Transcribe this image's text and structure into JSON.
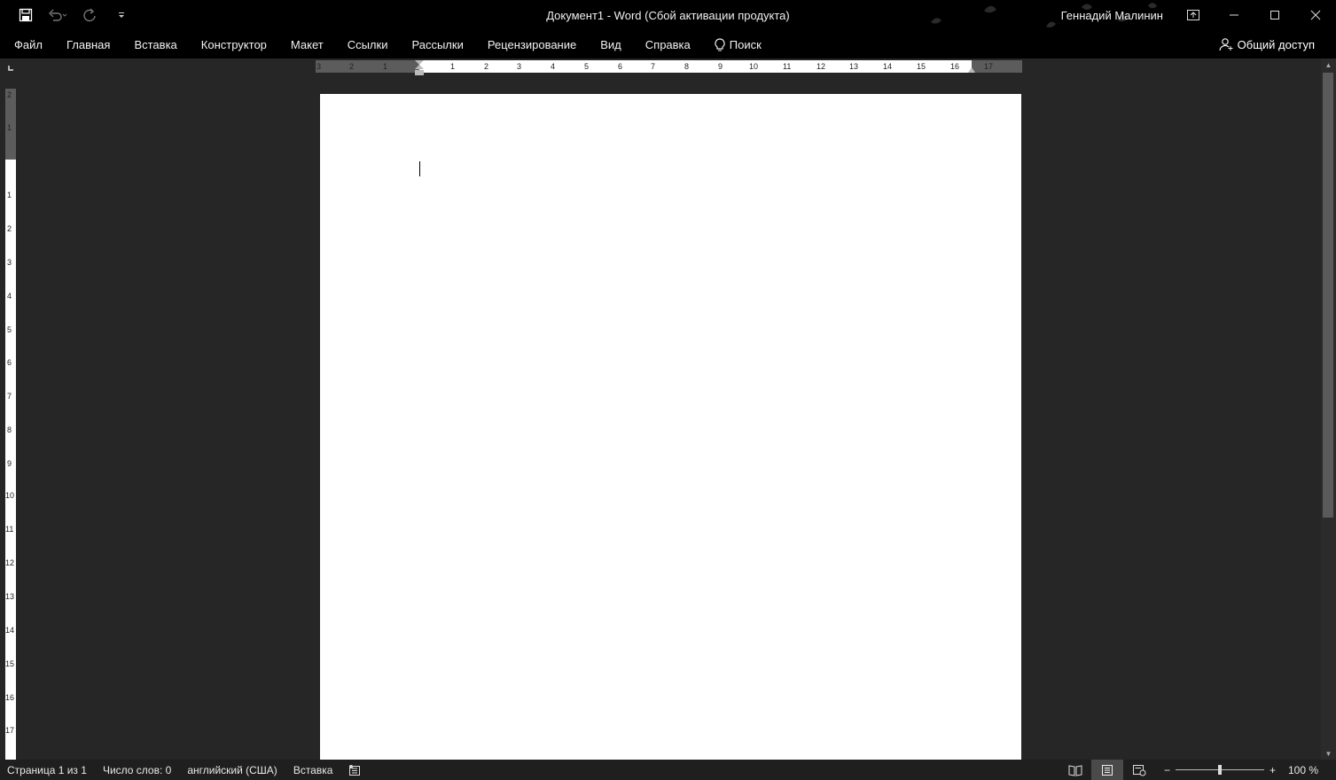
{
  "window": {
    "title": "Документ1  -  Word (Сбой активации продукта)",
    "user": "Геннадий Малинин"
  },
  "menu": {
    "items": [
      "Файл",
      "Главная",
      "Вставка",
      "Конструктор",
      "Макет",
      "Ссылки",
      "Рассылки",
      "Рецензирование",
      "Вид",
      "Справка"
    ],
    "search_label": "Поиск",
    "share_label": "Общий доступ"
  },
  "ruler": {
    "horizontal_labels": [
      "3",
      "2",
      "1",
      "1",
      "2",
      "3",
      "4",
      "5",
      "6",
      "7",
      "8",
      "9",
      "10",
      "11",
      "12",
      "13",
      "14",
      "15",
      "16",
      "17"
    ],
    "vertical_labels": [
      "2",
      "1",
      "1",
      "2",
      "3",
      "4",
      "5",
      "6",
      "7",
      "8",
      "9",
      "10",
      "11",
      "12",
      "13",
      "14",
      "15",
      "16",
      "17"
    ]
  },
  "status": {
    "page": "Страница 1 из 1",
    "words": "Число слов: 0",
    "language": "английский (США)",
    "mode": "Вставка",
    "zoom": "100 %"
  },
  "colors": {
    "titlebar": "#000000",
    "workspace": "#262626",
    "statusbar": "#1f1f1f",
    "page": "#ffffff"
  }
}
